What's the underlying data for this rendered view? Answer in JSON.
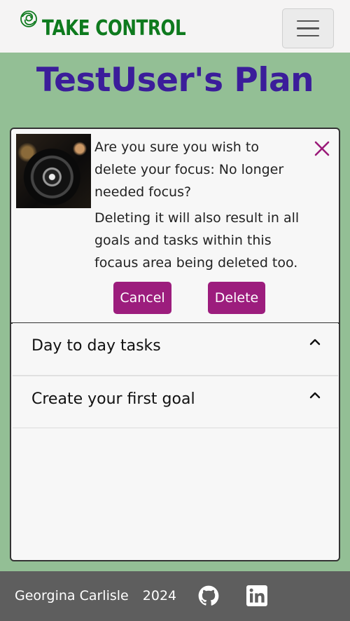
{
  "navbar": {
    "brand_text": "TAKE CONTROL",
    "logo_icon": "leaf-swirl-icon",
    "menu_icon": "hamburger-icon"
  },
  "page": {
    "title": "TestUser's Plan"
  },
  "alert": {
    "message_line1": "Are you sure you wish to delete your focus: No longer needed focus?",
    "message_line2": "Deleting it will also result in all goals and tasks within this focaus area being deleted too.",
    "close_label": "X",
    "cancel_label": "Cancel",
    "delete_label": "Delete"
  },
  "accordion": {
    "items": [
      {
        "label": "Day to day tasks"
      },
      {
        "label": "Create your first goal"
      }
    ]
  },
  "footer": {
    "author": "Georgina Carlisle",
    "year": "2024",
    "icons": [
      "github-icon",
      "linkedin-icon"
    ]
  },
  "colors": {
    "page_bg": "#93bf95",
    "brand_green": "#0e7a1e",
    "title_purple": "#3b1d9a",
    "button_magenta": "#9c1d7d",
    "footer_bg": "#5e5e5e"
  }
}
